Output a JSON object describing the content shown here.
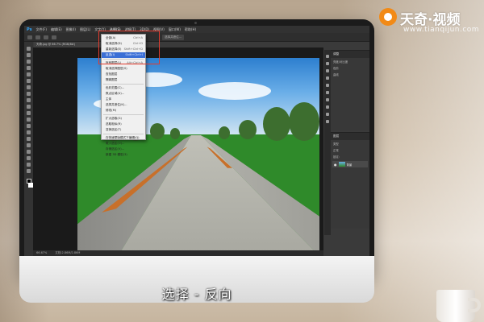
{
  "watermark": {
    "brand": "天奇·视频",
    "url": "www.tianqijun.com"
  },
  "subtitle": "选择 - 反向",
  "photoshop": {
    "app_icon": "Ps",
    "menus": [
      "文件(F)",
      "编辑(E)",
      "图像(I)",
      "图层(L)",
      "文字(Y)",
      "选择(S)",
      "滤镜(T)",
      "3D(D)",
      "视图(V)",
      "窗口(W)",
      "帮助(H)"
    ],
    "active_menu_index": 5,
    "options_button": "选择并遮住...",
    "document_tab": "天奇.jpg @ 66.7% (RGB/8#)",
    "status": {
      "zoom": "66.67%",
      "doc_info": "文档:2.86M/2.86M"
    },
    "select_menu": {
      "items": [
        {
          "label": "全部(A)",
          "shortcut": "Ctrl+A"
        },
        {
          "label": "取消选择(D)",
          "shortcut": "Ctrl+D"
        },
        {
          "label": "重新选择(E)",
          "shortcut": "Shift+Ctrl+D"
        },
        {
          "label": "反选(I)",
          "shortcut": "Shift+Ctrl+I",
          "selected": true
        },
        {
          "sep": true
        },
        {
          "label": "所有图层(L)",
          "shortcut": "Alt+Ctrl+A"
        },
        {
          "label": "取消选择图层(S)",
          "shortcut": ""
        },
        {
          "label": "查找图层",
          "shortcut": ""
        },
        {
          "label": "隔离图层",
          "shortcut": ""
        },
        {
          "sep": true
        },
        {
          "label": "色彩范围(C)...",
          "shortcut": ""
        },
        {
          "label": "焦点区域(U)...",
          "shortcut": ""
        },
        {
          "label": "主体",
          "shortcut": ""
        },
        {
          "label": "选择并遮住(K)...",
          "shortcut": ""
        },
        {
          "label": "修改(M)",
          "shortcut": ""
        },
        {
          "sep": true
        },
        {
          "label": "扩大选取(G)",
          "shortcut": ""
        },
        {
          "label": "选取相似(R)",
          "shortcut": ""
        },
        {
          "label": "变换选区(T)",
          "shortcut": ""
        },
        {
          "sep": true
        },
        {
          "label": "在快速蒙版模式下编辑(Q)",
          "shortcut": ""
        },
        {
          "label": "载入选区(O)...",
          "shortcut": ""
        },
        {
          "label": "存储选区(V)...",
          "shortcut": ""
        },
        {
          "label": "新建 3D 模型(3)",
          "shortcut": ""
        }
      ]
    },
    "panels": {
      "adjust_title": "调整",
      "adjust_rows": [
        "亮度/对比度",
        "色阶",
        "曲线"
      ],
      "layers_title": "图层",
      "layers_rows": [
        "类型",
        "正常",
        "锁定:"
      ],
      "layer_name": "背景"
    }
  }
}
